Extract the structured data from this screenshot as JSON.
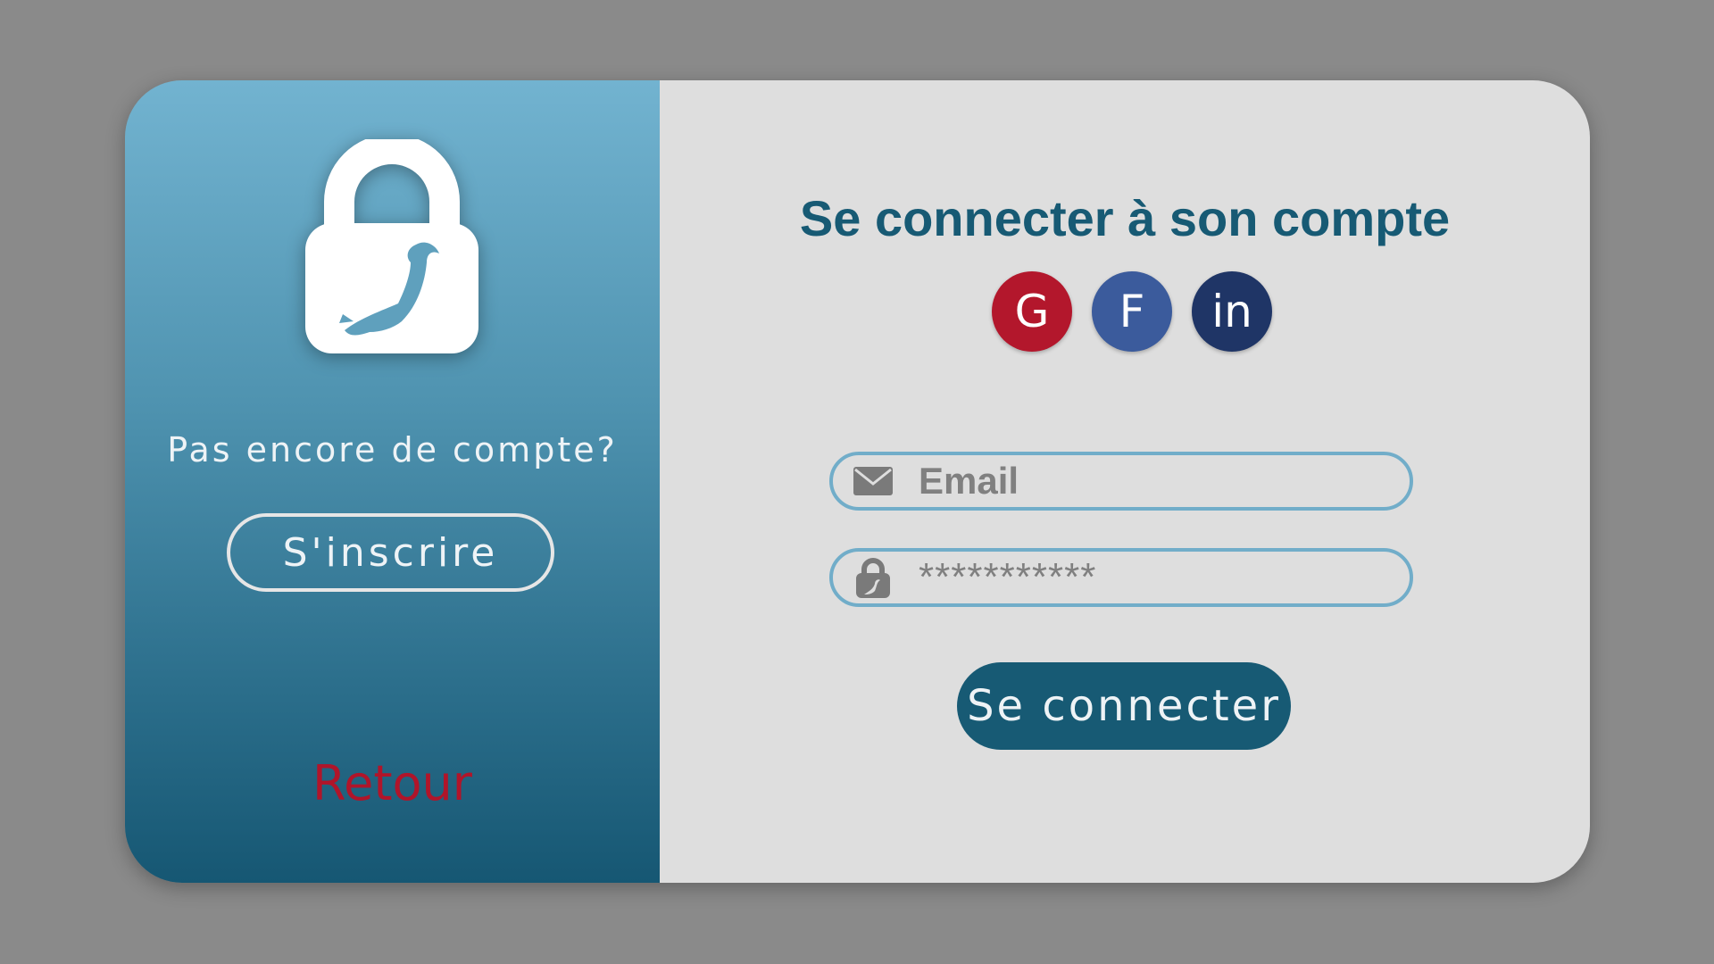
{
  "left_panel": {
    "no_account_text": "Pas encore de compte?",
    "signup_label": "S'inscrire",
    "back_label": "Retour",
    "logo_icon": "padlock-dinosaur-icon"
  },
  "login": {
    "title": "Se connecter à son compte",
    "social": [
      {
        "label": "G",
        "icon": "google-icon",
        "color": "#b3172c"
      },
      {
        "label": "F",
        "icon": "facebook-icon",
        "color": "#3b5b9c"
      },
      {
        "label": "in",
        "icon": "linkedin-icon",
        "color": "#1f3566"
      }
    ],
    "email_placeholder": "Email",
    "email_icon": "envelope-icon",
    "password_value": "***********",
    "password_icon": "lock-icon",
    "submit_label": "Se connecter"
  },
  "colors": {
    "primary": "#175a74",
    "accent_red": "#b0152a",
    "field_border": "#71adc9",
    "panel_bg": "#dedede",
    "backdrop": "#8a8a8a"
  }
}
